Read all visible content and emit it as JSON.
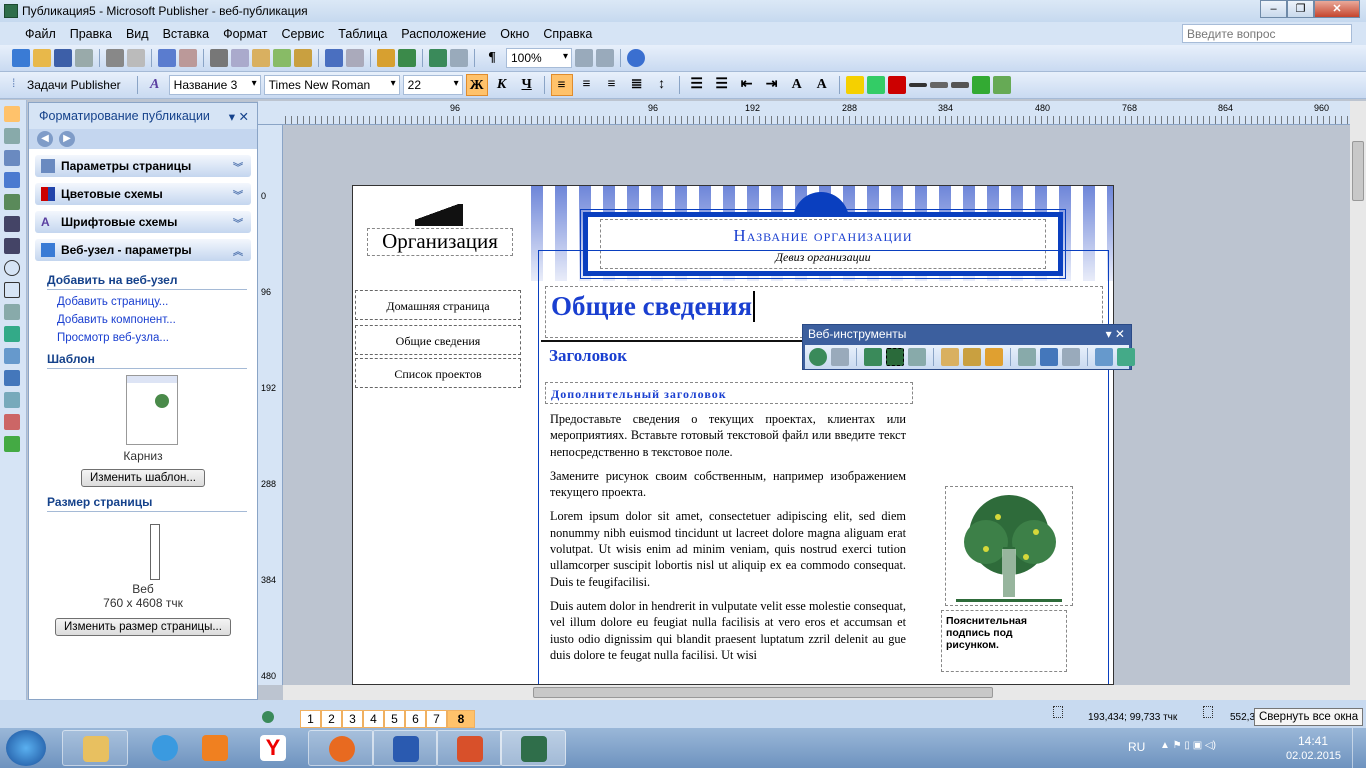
{
  "window": {
    "title": "Публикация5 - Microsoft Publisher - веб-публикация"
  },
  "menu": [
    "Файл",
    "Правка",
    "Вид",
    "Вставка",
    "Формат",
    "Сервис",
    "Таблица",
    "Расположение",
    "Окно",
    "Справка"
  ],
  "ask_placeholder": "Введите вопрос",
  "toolbar": {
    "zoom": "100%",
    "tasks_label": "Задачи Publisher",
    "style": "Название 3",
    "font": "Times New Roman",
    "size": "22",
    "bold": "Ж",
    "italic": "К",
    "underline": "Ч"
  },
  "task_pane": {
    "title": "Форматирование публикации",
    "sections": [
      "Параметры страницы",
      "Цветовые схемы",
      "Шрифтовые схемы",
      "Веб-узел - параметры"
    ],
    "add_header": "Добавить на веб-узел",
    "links": [
      "Добавить страницу...",
      "Добавить компонент...",
      "Просмотр веб-узла..."
    ],
    "template_header": "Шаблон",
    "template_name": "Карниз",
    "change_template": "Изменить шаблон...",
    "size_header": "Размер страницы",
    "size_name": "Веб",
    "size_dims": "760 x 4608 тчк",
    "change_size": "Изменить размер страницы..."
  },
  "ruler": {
    "h": [
      "96",
      "96",
      "192",
      "288",
      "384",
      "480",
      "768",
      "864",
      "960"
    ],
    "v": [
      "0",
      "96",
      "192",
      "288",
      "384",
      "480"
    ]
  },
  "page": {
    "org": "Организация",
    "org_name": "Название организации",
    "motto": "Девиз организации",
    "nav": [
      "Домашняя страница",
      "Общие сведения",
      "Список проектов"
    ],
    "heading": "Общие сведения",
    "subheading": "Заголовок",
    "minor_heading": "Дополнительный заголовок",
    "paragraphs": [
      "Предоставьте сведения о текущих проектах, клиентах или мероприятиях. Вставьте готовый текстовой файл или введите текст непосредственно в текстовое поле.",
      "Замените рисунок своим собственным, например изображением текущего проекта.",
      "Lorem ipsum dolor sit amet, consectetuer adipiscing elit, sed diem nonummy nibh euismod tincidunt ut lacreet dolore magna aliguam erat volutpat. Ut wisis enim ad minim veniam, quis nostrud exerci tution ullamcorper suscipit lobortis nisl ut aliquip ex ea commodo consequat. Duis te feugifacilisi.",
      "Duis autem dolor in hendrerit in vulputate velit esse molestie consequat, vel illum dolore eu feugiat nulla facilisis at vero eros et accumsan et iusto odio dignissim qui blandit praesent luptatum zzril delenit au gue duis dolore te feugat nulla facilisi. Ut wisi"
    ],
    "caption": "Пояснительная подпись под рисунком."
  },
  "webtools": {
    "title": "Веб-инструменты"
  },
  "status": {
    "pages": [
      "1",
      "2",
      "3",
      "4",
      "5",
      "6",
      "7",
      "8"
    ],
    "current_page": "8",
    "position": "193,434; 99,733 тчк",
    "size": "552,3",
    "tooltip": "Свернуть все окна"
  },
  "tray": {
    "lang": "RU",
    "time": "14:41",
    "date": "02.02.2015"
  }
}
